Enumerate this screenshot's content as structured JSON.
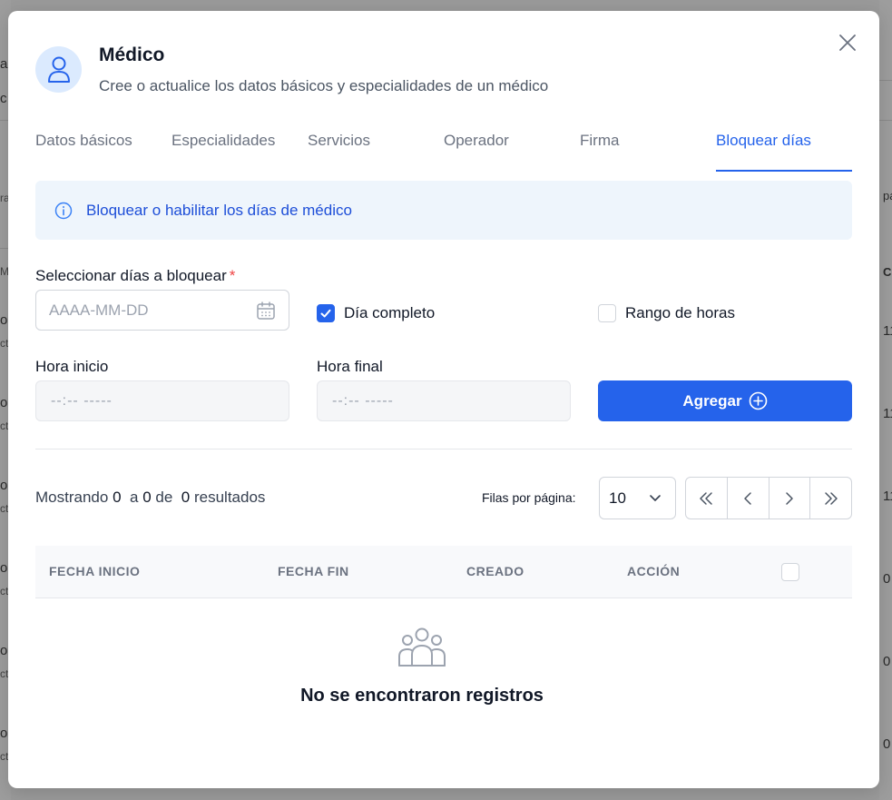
{
  "background": {
    "left_fragments": [
      "a",
      "c",
      "ra",
      "M",
      "oc",
      "ct",
      "oc",
      "ct",
      "oc",
      "ct",
      "oc",
      "ct",
      "oc",
      "ct",
      "oc",
      "ct"
    ],
    "right_fragments": [
      "pá",
      "CI",
      "11",
      "11",
      "11",
      "0",
      "0",
      "0"
    ]
  },
  "modal": {
    "title": "Médico",
    "subtitle": "Cree o actualice los datos básicos y especialidades de un médico",
    "avatar_icon": "user-icon",
    "close_icon": "close-icon"
  },
  "tabs": [
    {
      "label": "Datos básicos",
      "active": false
    },
    {
      "label": "Especialidades",
      "active": false
    },
    {
      "label": "Servicios",
      "active": false
    },
    {
      "label": "Operador",
      "active": false
    },
    {
      "label": "Firma",
      "active": false
    },
    {
      "label": "Bloquear días",
      "active": true
    }
  ],
  "info": {
    "icon": "info-icon",
    "text": "Bloquear o habilitar los días de médico"
  },
  "form": {
    "dates_label": "Seleccionar días a bloquear",
    "required_mark": "*",
    "date_placeholder": "AAAA-MM-DD",
    "full_day_label": "Día completo",
    "full_day_checked": true,
    "hour_range_label": "Rango de horas",
    "hour_range_checked": false,
    "start_label": "Hora inicio",
    "end_label": "Hora final",
    "start_placeholder": "--:-- -----",
    "end_placeholder": "--:-- -----",
    "add_button": "Agregar"
  },
  "pagination": {
    "summary_prefix": "Mostrando",
    "from": "0",
    "to_word": "a",
    "to": "0",
    "of_word": "de",
    "total": "0",
    "results_word": "resultados",
    "rows_label": "Filas por página:",
    "rows_value": "10"
  },
  "table": {
    "headers": [
      "FECHA INICIO",
      "FECHA FIN",
      "CREADO",
      "ACCIÓN"
    ],
    "empty_text": "No se encontraron registros"
  },
  "colors": {
    "accent": "#2563eb",
    "info_bg": "#eef5fc",
    "required": "#ef4444"
  }
}
